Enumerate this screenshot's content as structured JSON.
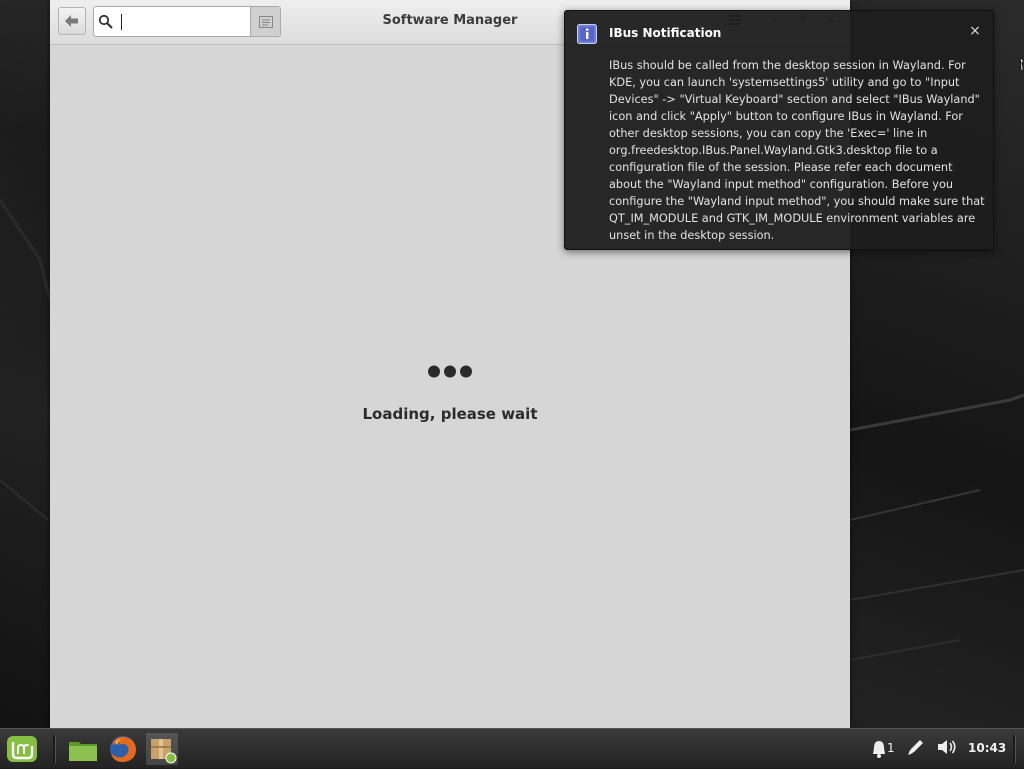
{
  "window": {
    "title": "Software Manager",
    "search": {
      "value": "",
      "placeholder": ""
    },
    "controls": {
      "minimize": "–",
      "maximize": "+",
      "close": "×"
    },
    "loading_text": "Loading, please wait"
  },
  "notification": {
    "title": "IBus Notification",
    "body": "IBus should be called from the desktop session in Wayland. For KDE, you can launch 'systemsettings5' utility and go to \"Input Devices\" -> \"Virtual Keyboard\" section and select \"IBus Wayland\" icon and click \"Apply\" button to configure IBus in Wayland. For other desktop sessions, you can copy the 'Exec=' line in org.freedesktop.IBus.Panel.Wayland.Gtk3.desktop file to a configuration file of the session. Please refer each document about the \"Wayland input method\" configuration. Before you configure the \"Wayland input method\", you should make sure that QT_IM_MODULE and GTK_IM_MODULE environment variables are unset in the desktop session.",
    "close": "×"
  },
  "panel": {
    "launchers": [
      {
        "name": "files",
        "icon": "folder-icon"
      },
      {
        "name": "firefox",
        "icon": "firefox-icon"
      },
      {
        "name": "software-manager",
        "icon": "package-icon"
      }
    ],
    "tray": {
      "notifications_count": "1",
      "clock": "10:43"
    }
  },
  "colors": {
    "window_bg": "#d6d6d6",
    "notification_bg": "#1e1e1e",
    "panel_bg": "#2b2b2b",
    "mint_green": "#86be43"
  }
}
